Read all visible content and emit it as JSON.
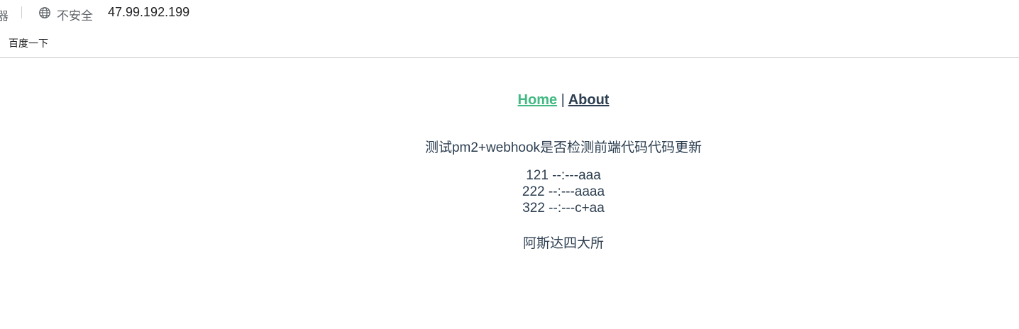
{
  "browser": {
    "reader_icon": "器",
    "security_label": "不安全",
    "url": "47.99.192.199",
    "bookmarks": [
      {
        "label": "百度一下"
      }
    ]
  },
  "nav": {
    "home_label": "Home",
    "divider": "|",
    "about_label": "About"
  },
  "content": {
    "title": "测试pm2+webhook是否检测前端代码代码更新",
    "items": [
      "121 --:---aaa",
      "222 --:---aaaa",
      "322 --:---c+aa"
    ],
    "footer": "阿斯达四大所"
  }
}
